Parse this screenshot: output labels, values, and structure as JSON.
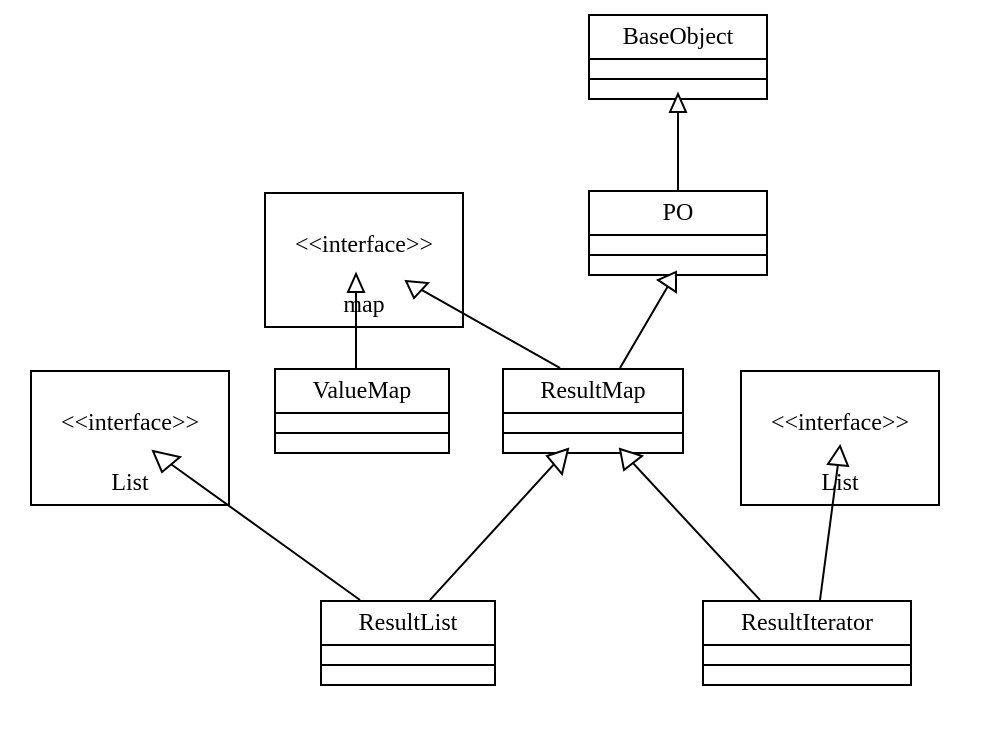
{
  "nodes": {
    "baseObject": {
      "title": "BaseObject",
      "stereotype": "",
      "compartments": 2
    },
    "po": {
      "title": "PO",
      "stereotype": "",
      "compartments": 2
    },
    "ifMap": {
      "title": "map",
      "stereotype": "<<interface>>",
      "compartments": 0
    },
    "valueMap": {
      "title": "ValueMap",
      "stereotype": "",
      "compartments": 2
    },
    "resultMap": {
      "title": "ResultMap",
      "stereotype": "",
      "compartments": 2
    },
    "ifListL": {
      "title": "List",
      "stereotype": "<<interface>>",
      "compartments": 0
    },
    "ifListR": {
      "title": "List",
      "stereotype": "<<interface>>",
      "compartments": 0
    },
    "resultList": {
      "title": "ResultList",
      "stereotype": "",
      "compartments": 2
    },
    "resultIter": {
      "title": "ResultIterator",
      "stereotype": "",
      "compartments": 2
    }
  },
  "edges": [
    {
      "from": "po",
      "to": "baseObject",
      "kind": "generalization"
    },
    {
      "from": "valueMap",
      "to": "ifMap",
      "kind": "realization"
    },
    {
      "from": "resultMap",
      "to": "ifMap",
      "kind": "realization"
    },
    {
      "from": "resultMap",
      "to": "po",
      "kind": "generalization"
    },
    {
      "from": "resultList",
      "to": "ifListL",
      "kind": "realization"
    },
    {
      "from": "resultList",
      "to": "resultMap",
      "kind": "generalization"
    },
    {
      "from": "resultIter",
      "to": "resultMap",
      "kind": "generalization"
    },
    {
      "from": "resultIter",
      "to": "ifListR",
      "kind": "realization"
    }
  ]
}
